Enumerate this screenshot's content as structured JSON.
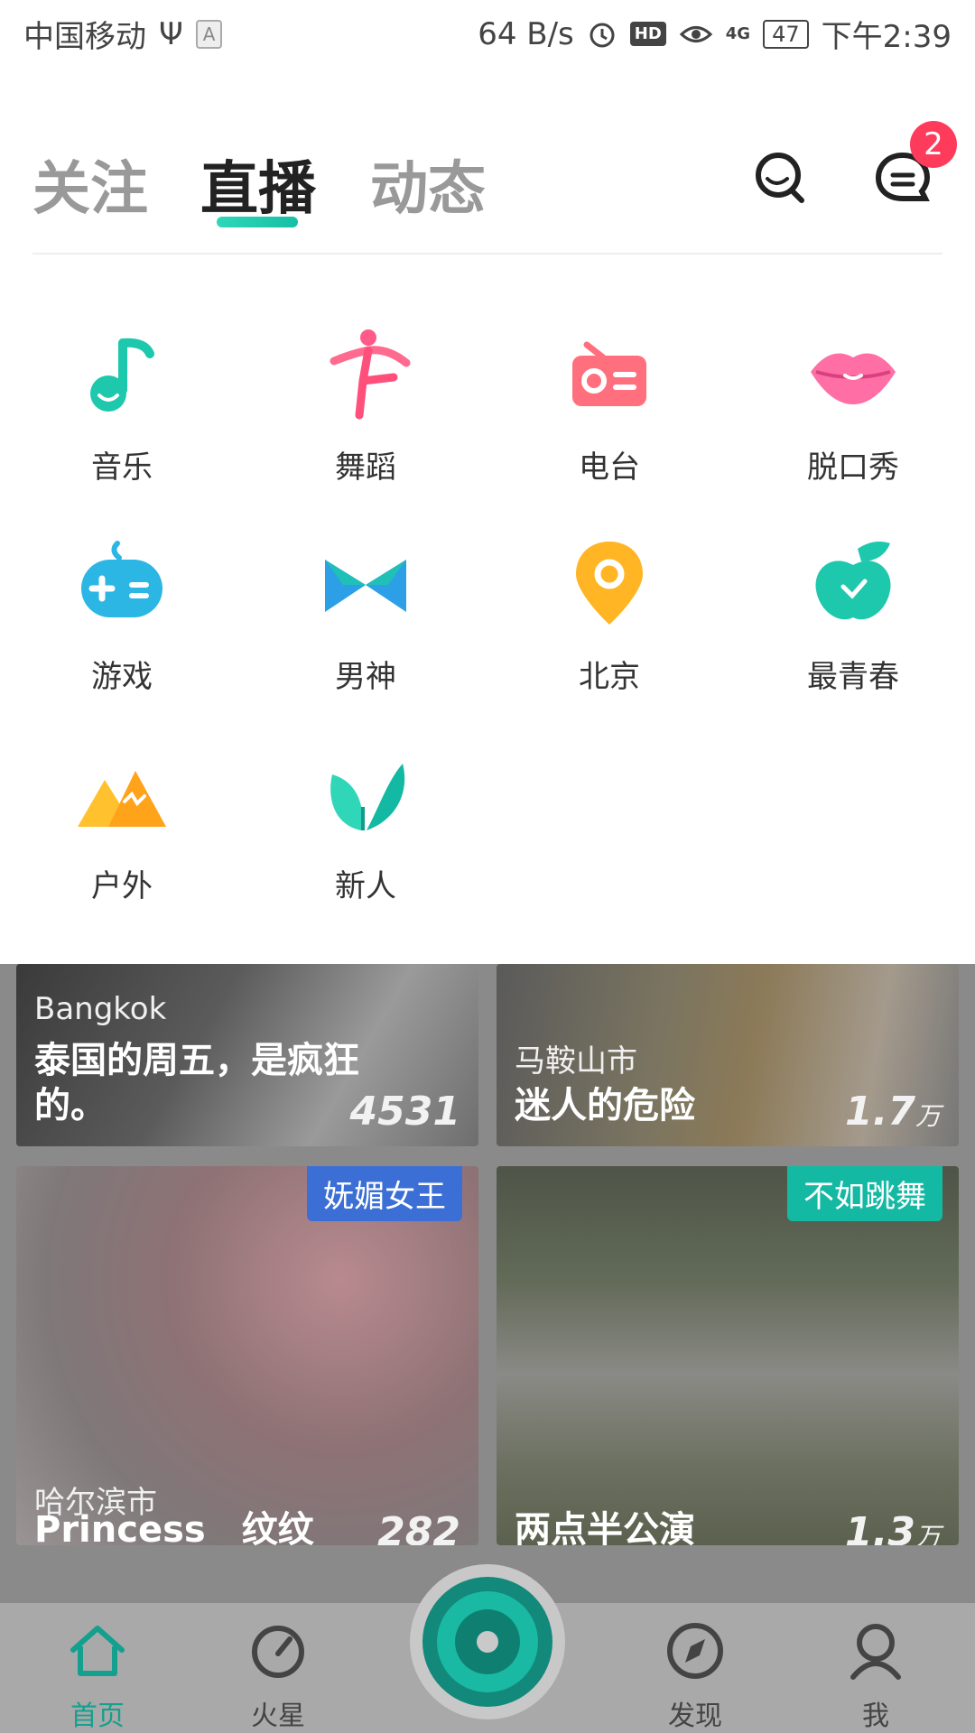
{
  "status_bar": {
    "carrier": "中国移动",
    "usb_symbol": "Ψ",
    "input_indicator": "A",
    "speed": "64 B/s",
    "hd": "HD",
    "signal": "4G",
    "battery": "47",
    "time": "下午2:39"
  },
  "header": {
    "tabs": [
      {
        "label": "关注",
        "active": false
      },
      {
        "label": "直播",
        "active": true
      },
      {
        "label": "动态",
        "active": false
      }
    ],
    "message_badge": "2",
    "accent_color": "#1ec8ad"
  },
  "categories": [
    {
      "label": "音乐",
      "icon": "music-note-icon"
    },
    {
      "label": "舞蹈",
      "icon": "dancer-icon"
    },
    {
      "label": "电台",
      "icon": "radio-icon"
    },
    {
      "label": "脱口秀",
      "icon": "lips-icon"
    },
    {
      "label": "游戏",
      "icon": "gamepad-icon"
    },
    {
      "label": "男神",
      "icon": "bowtie-icon"
    },
    {
      "label": "北京",
      "icon": "location-pin-icon"
    },
    {
      "label": "最青春",
      "icon": "apple-icon"
    },
    {
      "label": "户外",
      "icon": "mountain-icon"
    },
    {
      "label": "新人",
      "icon": "leaf-icon"
    }
  ],
  "feed": [
    {
      "location": "Bangkok",
      "title": "泰国的周五，是疯狂的。",
      "count": "4531",
      "unit": ""
    },
    {
      "location": "马鞍山市",
      "title": "迷人的危险",
      "count": "1.7",
      "unit": "万"
    },
    {
      "tag": "妩媚女王",
      "location": "哈尔滨市",
      "title": "Princess__纹纹",
      "count": "282",
      "unit": ""
    },
    {
      "tag": "不如跳舞",
      "location": "",
      "title": "两点半公演",
      "count": "1.3",
      "unit": "万"
    }
  ],
  "bottom_nav": [
    {
      "label": "首页",
      "icon": "home-icon",
      "active": true
    },
    {
      "label": "火星",
      "icon": "gauge-icon",
      "active": false
    },
    {
      "label": "发现",
      "icon": "compass-icon",
      "active": false
    },
    {
      "label": "我",
      "icon": "user-icon",
      "active": false
    }
  ]
}
